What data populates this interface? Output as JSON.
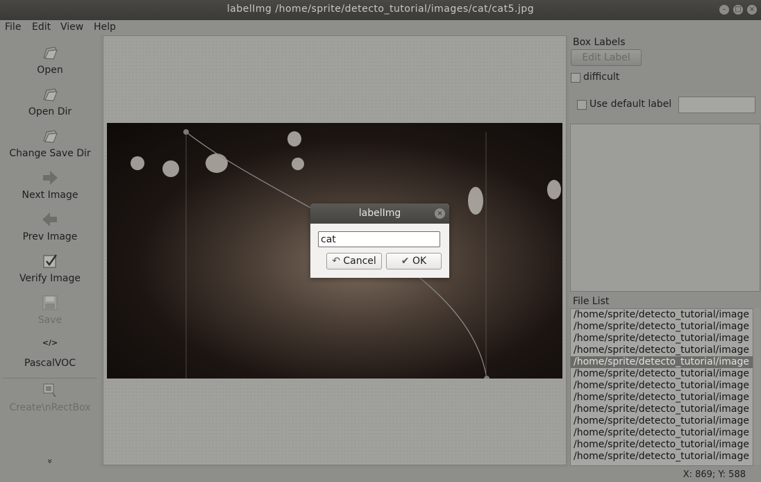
{
  "window": {
    "title": "labelImg /home/sprite/detecto_tutorial/images/cat/cat5.jpg"
  },
  "menu": [
    "File",
    "Edit",
    "View",
    "Help"
  ],
  "toolbar": {
    "open": "Open",
    "open_dir": "Open Dir",
    "change_save_dir": "Change Save Dir",
    "next_image": "Next Image",
    "prev_image": "Prev Image",
    "verify_image": "Verify Image",
    "save": "Save",
    "format_icon": "</>",
    "format": "PascalVOC",
    "create_rect_box": "Create\\nRectBox",
    "more": "»"
  },
  "right_panel": {
    "box_labels_title": "Box Labels",
    "edit_label": "Edit Label",
    "difficult": "difficult",
    "use_default_label": "Use default label",
    "default_label_value": "",
    "file_list_title": "File List",
    "files": [
      "/home/sprite/detecto_tutorial/image",
      "/home/sprite/detecto_tutorial/image",
      "/home/sprite/detecto_tutorial/image",
      "/home/sprite/detecto_tutorial/image",
      "/home/sprite/detecto_tutorial/image",
      "/home/sprite/detecto_tutorial/image",
      "/home/sprite/detecto_tutorial/image",
      "/home/sprite/detecto_tutorial/image",
      "/home/sprite/detecto_tutorial/image",
      "/home/sprite/detecto_tutorial/image",
      "/home/sprite/detecto_tutorial/image",
      "/home/sprite/detecto_tutorial/image",
      "/home/sprite/detecto_tutorial/image"
    ],
    "selected_file_index": 4
  },
  "dialog": {
    "title": "labelImg",
    "input_value": "cat",
    "cancel": "Cancel",
    "ok": "OK"
  },
  "status": {
    "text": "X: 869; Y: 588"
  }
}
